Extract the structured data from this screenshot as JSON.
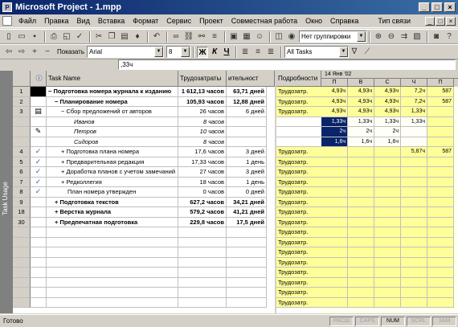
{
  "window": {
    "title": "Microsoft Project - 1.mpp",
    "controls": [
      "_",
      "□",
      "×"
    ]
  },
  "menu": {
    "items": [
      "Файл",
      "Правка",
      "Вид",
      "Вставка",
      "Формат",
      "Сервис",
      "Проект",
      "Совместная работа",
      "Окно",
      "Справка"
    ],
    "help_box": "Тип связи",
    "mdi_controls": [
      "_",
      "□",
      "×"
    ]
  },
  "toolbar1": {
    "group_combo": "Нет группировки"
  },
  "toolbar2": {
    "show_label": "Показать",
    "font_combo": "Arial",
    "size_combo": "8",
    "bold": "Ж",
    "italic": "К",
    "underline": "Ч",
    "filter_combo": "All Tasks"
  },
  "entry": {
    "value": ",33ч"
  },
  "viewbar": {
    "label": "Task Usage"
  },
  "sheet": {
    "headers": {
      "id": "",
      "indicator": "ⓘ",
      "name": "Task Name",
      "work": "Трудозатраты",
      "duration": "ительност"
    },
    "rows": [
      {
        "id": "1",
        "ind": "black",
        "name": "− Подготовка номера журнала к изданию",
        "work": "1 612,13 часов",
        "dur": "63,71 дней",
        "bold": true,
        "indent": 0
      },
      {
        "id": "2",
        "ind": "",
        "name": "− Планирование номера",
        "work": "105,93 часов",
        "dur": "12,88 дней",
        "bold": true,
        "indent": 1
      },
      {
        "id": "3",
        "ind": "table",
        "name": "− Сбор предложений от авторов",
        "work": "26 часов",
        "dur": "6 дней",
        "bold": false,
        "indent": 2
      },
      {
        "id": "",
        "ind": "",
        "name": "Иванов",
        "work": "8 часов",
        "dur": "",
        "italic": true,
        "indent": 4
      },
      {
        "id": "",
        "ind": "note",
        "name": "Петров",
        "work": "10 часов",
        "dur": "",
        "italic": true,
        "indent": 4
      },
      {
        "id": "",
        "ind": "",
        "name": "Сидоров",
        "work": "8 часов",
        "dur": "",
        "italic": true,
        "indent": 4
      },
      {
        "id": "4",
        "ind": "check",
        "name": "+ Подготовка плана номера",
        "work": "17,6 часов",
        "dur": "3 дней",
        "bold": false,
        "indent": 2
      },
      {
        "id": "5",
        "ind": "check",
        "name": "+ Предварительная редакция",
        "work": "17,33 часов",
        "dur": "1 день",
        "bold": false,
        "indent": 2
      },
      {
        "id": "6",
        "ind": "check",
        "name": "+ Доработка планов с учетом замечаний",
        "work": "27 часов",
        "dur": "3 дней",
        "bold": false,
        "indent": 2
      },
      {
        "id": "7",
        "ind": "check",
        "name": "+ Редколлегия",
        "work": "18 часов",
        "dur": "1 день",
        "bold": false,
        "indent": 2
      },
      {
        "id": "8",
        "ind": "check",
        "name": "План номера утвержден",
        "work": "0 часов",
        "dur": "0 дней",
        "bold": false,
        "indent": 3
      },
      {
        "id": "9",
        "ind": "",
        "name": "+ Подготовка текстов",
        "work": "627,2 часов",
        "dur": "34,21 дней",
        "bold": true,
        "indent": 1
      },
      {
        "id": "18",
        "ind": "",
        "name": "+ Верстка журнала",
        "work": "579,2 часов",
        "dur": "41,21 дней",
        "bold": true,
        "indent": 1
      },
      {
        "id": "30",
        "ind": "",
        "name": "+ Предпечатная подготовка",
        "work": "229,8 часов",
        "dur": "17,5 дней",
        "bold": true,
        "indent": 1
      },
      {
        "id": "",
        "ind": "",
        "name": "",
        "work": "",
        "dur": ""
      },
      {
        "id": "",
        "ind": "",
        "name": "",
        "work": "",
        "dur": ""
      },
      {
        "id": "",
        "ind": "",
        "name": "",
        "work": "",
        "dur": ""
      },
      {
        "id": "",
        "ind": "",
        "name": "",
        "work": "",
        "dur": ""
      },
      {
        "id": "",
        "ind": "",
        "name": "",
        "work": "",
        "dur": ""
      },
      {
        "id": "",
        "ind": "",
        "name": "",
        "work": "",
        "dur": ""
      },
      {
        "id": "",
        "ind": "",
        "name": "",
        "work": "",
        "dur": ""
      },
      {
        "id": "",
        "ind": "",
        "name": "",
        "work": "",
        "dur": ""
      }
    ]
  },
  "details": {
    "header": "Подробности",
    "rows": [
      "Трудозатр.",
      "Трудозатр.",
      "Трудозатр.",
      "",
      "",
      "",
      "Трудозатр.",
      "Трудозатр.",
      "Трудозатр.",
      "Трудозатр.",
      "Трудозатр.",
      "Трудозатр.",
      "Трудозатр.",
      "Трудозатр.",
      "Трудозатр.",
      "Трудозатр.",
      "Трудозатр.",
      "Трудозатр.",
      "Трудозатр.",
      "Трудозатр.",
      "Трудозатр.",
      "Трудозатр."
    ]
  },
  "timescale": {
    "week": "14 Янв '02",
    "days": [
      "П",
      "В",
      "С",
      "Ч",
      "П"
    ],
    "rows": [
      [
        "4,93ч",
        "4,93ч",
        "4,93ч",
        "7,2ч",
        "587"
      ],
      [
        "4,93ч",
        "4,93ч",
        "4,93ч",
        "7,2ч",
        "587"
      ],
      [
        "4,93ч",
        "4,93ч",
        "4,93ч",
        "1,33ч",
        ""
      ],
      [
        "1,33ч",
        "1,33ч",
        "1,33ч",
        "1,33ч",
        ""
      ],
      [
        "2ч",
        "2ч",
        "2ч",
        "",
        ""
      ],
      [
        "1,6ч",
        "1,6ч",
        "1,6ч",
        "",
        ""
      ],
      [
        "",
        "",
        "",
        "5,87ч",
        "587"
      ],
      [
        "",
        "",
        "",
        "",
        ""
      ],
      [
        "",
        "",
        "",
        "",
        ""
      ],
      [
        "",
        "",
        "",
        "",
        ""
      ],
      [
        "",
        "",
        "",
        "",
        ""
      ],
      [
        "",
        "",
        "",
        "",
        ""
      ],
      [
        "",
        "",
        "",
        "",
        ""
      ],
      [
        "",
        "",
        "",
        "",
        ""
      ],
      [
        "",
        "",
        "",
        "",
        ""
      ],
      [
        "",
        "",
        "",
        "",
        ""
      ],
      [
        "",
        "",
        "",
        "",
        ""
      ],
      [
        "",
        "",
        "",
        "",
        ""
      ],
      [
        "",
        "",
        "",
        "",
        ""
      ],
      [
        "",
        "",
        "",
        "",
        ""
      ],
      [
        "",
        "",
        "",
        "",
        ""
      ],
      [
        "",
        "",
        "",
        "",
        ""
      ]
    ]
  },
  "status": {
    "text": "Готово",
    "indicators": [
      {
        "label": "РАСШ",
        "on": false
      },
      {
        "label": "CAPS",
        "on": false
      },
      {
        "label": "NUM",
        "on": true
      },
      {
        "label": "SCRL",
        "on": false
      },
      {
        "label": "ЗАМ",
        "on": false
      }
    ]
  }
}
